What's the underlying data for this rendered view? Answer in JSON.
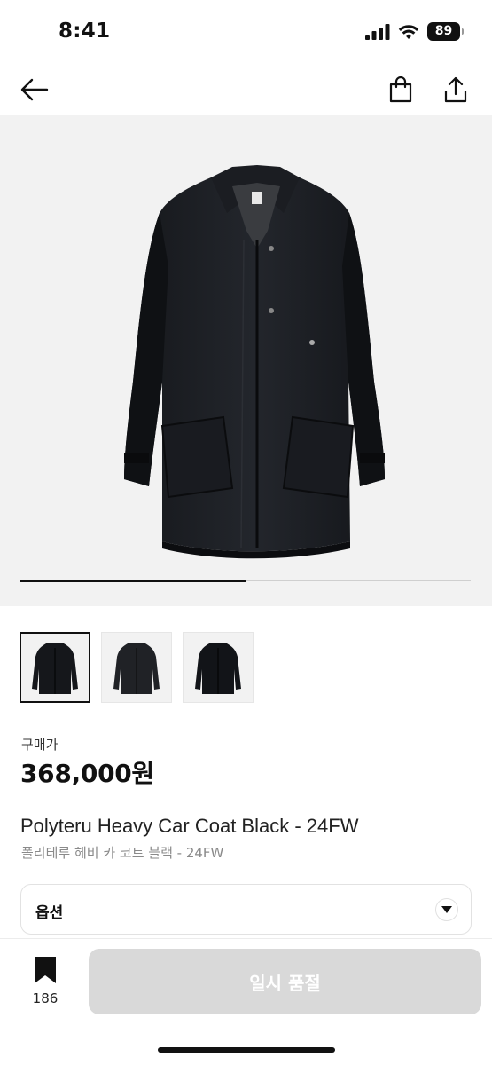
{
  "status": {
    "time": "8:41",
    "battery": "89"
  },
  "gallery": {
    "image_count": 3,
    "active_index": 1,
    "progress": 0.5
  },
  "product": {
    "price_label": "구매가",
    "price": "368,000원",
    "name_en": "Polyteru Heavy Car Coat Black - 24FW",
    "name_ko": "폴리테루 헤비 카 코트 블랙 - 24FW"
  },
  "option": {
    "label": "옵션"
  },
  "bottom": {
    "bookmark_count": "186",
    "cta_label": "일시 품절"
  },
  "colors": {
    "accent": "#111111",
    "cta_disabled": "#d9d9d9",
    "hero_bg": "#f2f2f2",
    "muted_text": "#8a8a8a"
  },
  "icons": {
    "back": "arrow-left-icon",
    "bag": "shopping-bag-icon",
    "share": "share-icon",
    "bookmark": "bookmark-icon",
    "chevron": "chevron-down-icon"
  }
}
